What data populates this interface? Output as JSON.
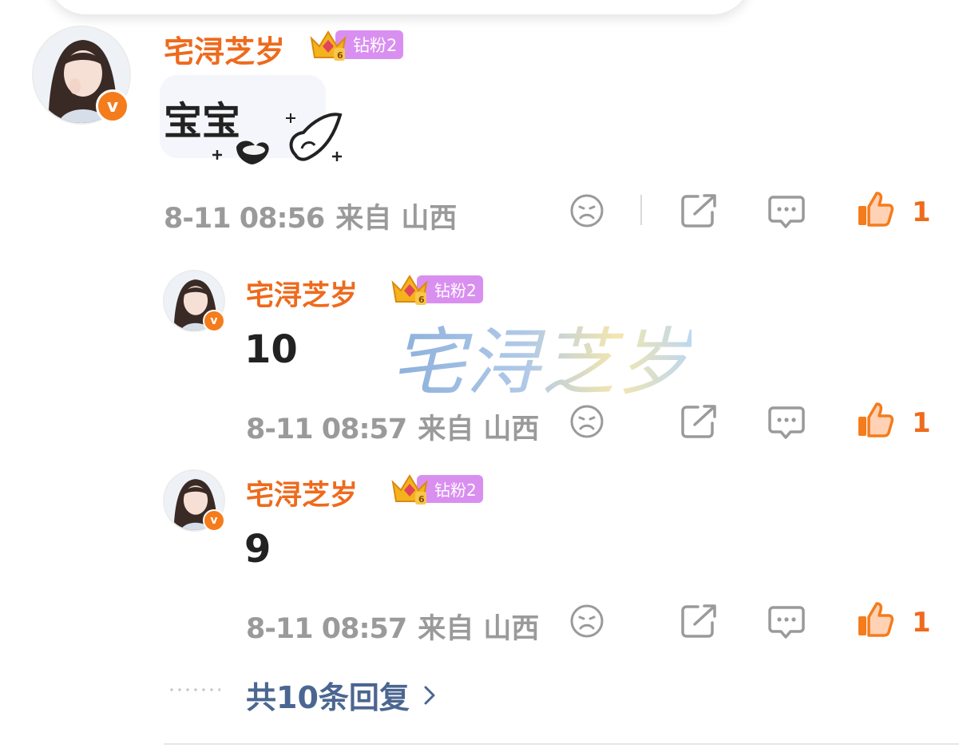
{
  "comment": {
    "username": "宅浔芝岁",
    "fan_badge": "钻粉2",
    "badge_level_digit": "6",
    "text": "宝宝",
    "time": "8-11 08:56",
    "location": "来自 山西",
    "like_count": "1"
  },
  "replies": [
    {
      "username": "宅浔芝岁",
      "fan_badge": "钻粉2",
      "badge_level_digit": "6",
      "text": "10",
      "time": "8-11 08:57",
      "location": "来自 山西",
      "like_count": "1"
    },
    {
      "username": "宅浔芝岁",
      "fan_badge": "钻粉2",
      "badge_level_digit": "6",
      "text": "9",
      "time": "8-11 08:57",
      "location": "来自 山西",
      "like_count": "1"
    }
  ],
  "more_replies_label": "共10条回复",
  "watermark_text": "宅浔芝岁",
  "verified_mark": "v",
  "colors": {
    "username": "#ee6a1c",
    "like_active": "#f47c1c",
    "link": "#4b6690",
    "meta": "#9a9a9a",
    "fan_badge_bg": "#d98ff0"
  },
  "icons": [
    "sad-face-icon",
    "share-icon",
    "comment-icon",
    "thumbs-up-icon",
    "chevron-right-icon",
    "heart-sticker-icon",
    "wing-sticker-icon",
    "crown-icon"
  ]
}
